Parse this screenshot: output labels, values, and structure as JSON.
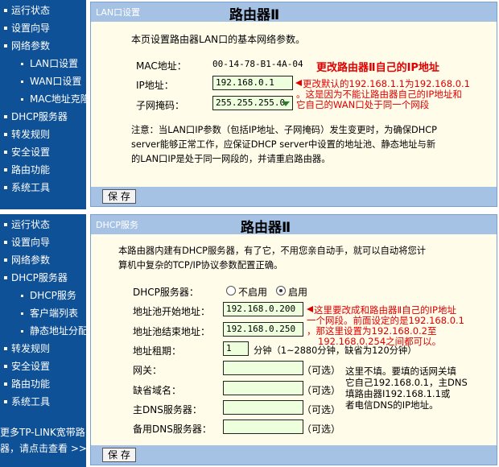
{
  "sidebar_top": {
    "items": [
      {
        "label": "运行状态",
        "sub": false
      },
      {
        "label": "设置向导",
        "sub": false
      },
      {
        "label": "网络参数",
        "sub": false
      },
      {
        "label": "LAN口设置",
        "sub": true
      },
      {
        "label": "WAN口设置",
        "sub": true
      },
      {
        "label": "MAC地址克隆",
        "sub": true
      },
      {
        "label": "DHCP服务器",
        "sub": false
      },
      {
        "label": "转发规则",
        "sub": false
      },
      {
        "label": "安全设置",
        "sub": false
      },
      {
        "label": "路由功能",
        "sub": false
      },
      {
        "label": "系统工具",
        "sub": false
      }
    ]
  },
  "sidebar_bottom": {
    "items": [
      {
        "label": "运行状态",
        "sub": false
      },
      {
        "label": "设置向导",
        "sub": false
      },
      {
        "label": "网络参数",
        "sub": false
      },
      {
        "label": "DHCP服务器",
        "sub": false
      },
      {
        "label": "DHCP服务",
        "sub": true
      },
      {
        "label": "客户端列表",
        "sub": true
      },
      {
        "label": "静态地址分配",
        "sub": true
      },
      {
        "label": "转发规则",
        "sub": false
      },
      {
        "label": "安全设置",
        "sub": false
      },
      {
        "label": "路由功能",
        "sub": false
      },
      {
        "label": "系统工具",
        "sub": false
      }
    ],
    "footer_line1": "更多TP-LINK宽带路由",
    "footer_line2": "器，请点击查看 >>"
  },
  "lan": {
    "header_label": "LAN口设置",
    "router_title": "路由器Ⅱ",
    "intro": "本页设置路由器LAN口的基本网络参数。",
    "mac_label": "MAC地址：",
    "mac_value": "00-14-78-B1-4A-04",
    "ip_label": "IP地址：",
    "ip_value": "192.168.0.1",
    "mask_label": "子网掩码：",
    "mask_value": "255.255.255.0",
    "note1": "注意：当LAN口IP参数（包括IP地址、子网掩码）发生变更时，为确保DHCP",
    "note2": "server能够正常工作，应保证DHCP server中设置的地址池、静态地址与新",
    "note3": "的LAN口IP是处于同一网段的，并请重启路由器。",
    "save_label": "保 存",
    "annot_title": "更改路由器Ⅱ自己的IP地址",
    "annot_line1": "更改默认的192.168.1.1为192.168.0.1",
    "annot_line2": "。这是因为不能让路由器自己的IP地址和",
    "annot_line3": "它自己的WAN口处于同一个网段"
  },
  "dhcp": {
    "header_label": "DHCP服务",
    "router_title": "路由器Ⅱ",
    "intro1": "本路由器内建有DHCP服务器，有了它，不用您亲自动手，就可以自动将您计",
    "intro2": "算机中复杂的TCP/IP协议参数配置正确。",
    "server_label": "DHCP服务器：",
    "radio_off": "不启用",
    "radio_on": "启用",
    "pool_start_label": "地址池开始地址：",
    "pool_start_value": "192.168.0.200",
    "pool_end_label": "地址池结束地址：",
    "pool_end_value": "192.168.0.250",
    "lease_label": "地址租期：",
    "lease_value": "1",
    "lease_unit": "分钟（1~2880分钟，缺省为120分钟）",
    "gateway_label": "网关：",
    "domain_label": "缺省域名：",
    "dns1_label": "主DNS服务器：",
    "dns2_label": "备用DNS服务器：",
    "optional": "（可选）",
    "save_label": "保 存",
    "annot1_line1": "这里要改成和路由器Ⅱ自己的IP地址",
    "annot1_line2": "一个网段。前面设定的是192.168.0.1",
    "annot1_line3": "，那这里设置为192.168.0.2至",
    "annot1_line4": "192.168.0.254之间都可以。",
    "annot2_line1": "这里不填。要填的话网关填",
    "annot2_line2": "它自己192.168.0.1，主DNS",
    "annot2_line3": "填路由器Ⅰ192.168.1.1或",
    "annot2_line4": "者电信DNS的IP地址。"
  }
}
